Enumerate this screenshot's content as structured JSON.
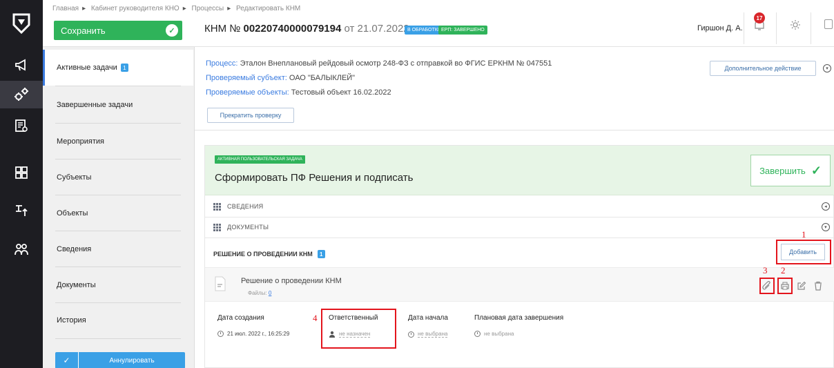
{
  "nav": {
    "rail_items": [
      {
        "name": "megaphone-icon"
      },
      {
        "name": "gears-icon",
        "active": true
      },
      {
        "name": "list-search-icon"
      },
      {
        "name": "dashboard-grid-icon"
      },
      {
        "name": "org-tree-icon"
      },
      {
        "name": "users-icon"
      }
    ]
  },
  "header": {
    "save_label": "Сохранить",
    "breadcrumb": [
      "Главная",
      "Кабинет руководителя КНО",
      "Процессы",
      "Редактировать КНМ"
    ],
    "title_prefix": "КНМ №",
    "title_number": "00220740000079194",
    "title_date": "от 21.07.2022",
    "status_badge": "В ОБРАБОТКЕ",
    "erp_badge": "ЕРП: ЗАВЕРШЕНО",
    "user": "Гиршон Д. А.",
    "notifications": "17"
  },
  "sidebar": {
    "items": [
      {
        "label": "Активные задачи",
        "count": "1",
        "active": true
      },
      {
        "label": "Завершенные задачи"
      },
      {
        "label": "Мероприятия"
      },
      {
        "label": "Субъекты"
      },
      {
        "label": "Объекты"
      },
      {
        "label": "Сведения"
      },
      {
        "label": "Документы"
      },
      {
        "label": "История"
      }
    ],
    "annul_label": "Аннулировать"
  },
  "info": {
    "process_label": "Процесс:",
    "process_value": "Эталон Внеплановый рейдовый осмотр 248-ФЗ с отправкой во ФГИС ЕРКНМ № 047551",
    "subject_label": "Проверяемый субъект:",
    "subject_value": "ОАО \"БАЛЫКЛЕЙ\"",
    "objects_label": "Проверяемые объекты:",
    "objects_value": "Тестовый объект 16.02.2022",
    "stop_button": "Прекратить проверку",
    "extra_action_button": "Дополнительное действие"
  },
  "task": {
    "tag": "АКТИВНАЯ ПОЛЬЗОВАТЕЛЬСКАЯ ЗАДАЧА",
    "title": "Сформировать ПФ Решения и подписать",
    "finish_label": "Завершить",
    "sections": [
      {
        "label": "СВЕДЕНИЯ"
      },
      {
        "label": "ДОКУМЕНТЫ"
      }
    ],
    "decision_label": "РЕШЕНИЕ О ПРОВЕДЕНИИ КНМ",
    "decision_count": "1",
    "add_label": "Добавить",
    "doc_name": "Решение о проведении КНМ",
    "doc_files_label": "Файлы:",
    "doc_files_count": "0",
    "meta": {
      "created_label": "Дата создания",
      "created_value": "21 июл. 2022 г., 16:25:29",
      "responsible_label": "Ответственный",
      "responsible_value": "не назначен",
      "start_label": "Дата начала",
      "start_value": "не выбрана",
      "planned_label": "Плановая дата завершения",
      "planned_value": "не выбрана"
    },
    "annotations": [
      "1",
      "2",
      "3",
      "4"
    ]
  },
  "colors": {
    "rail_bg": "#1d1d22",
    "accent_green": "#2fb35a",
    "accent_blue": "#3aa0e6",
    "highlight_red": "#e3141c"
  }
}
